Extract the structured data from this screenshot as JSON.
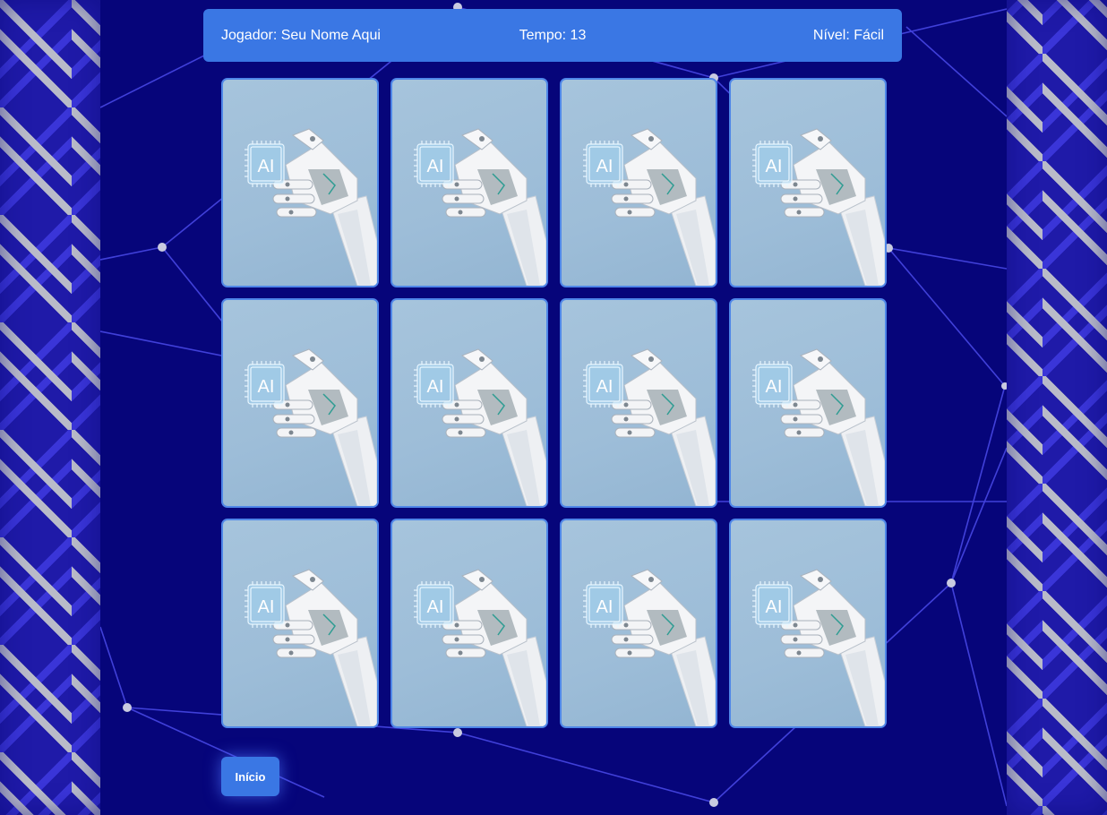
{
  "header": {
    "player": "Jogador: Seu Nome Aqui",
    "time": "Tempo: 13",
    "level": "Nível: Fácil"
  },
  "card_back": {
    "chip_label": "AI",
    "image": "robot-hand-holding-ai-chip"
  },
  "cards": [
    {
      "state": "face-down"
    },
    {
      "state": "face-down"
    },
    {
      "state": "face-down"
    },
    {
      "state": "face-down"
    },
    {
      "state": "face-down"
    },
    {
      "state": "face-down"
    },
    {
      "state": "face-down"
    },
    {
      "state": "face-down"
    },
    {
      "state": "face-down"
    },
    {
      "state": "face-down"
    },
    {
      "state": "face-down"
    },
    {
      "state": "face-down"
    }
  ],
  "buttons": {
    "home_label": "Início"
  },
  "colors": {
    "background": "#06057a",
    "accent": "#3a77e4",
    "card_back": "#a6c4dc"
  }
}
